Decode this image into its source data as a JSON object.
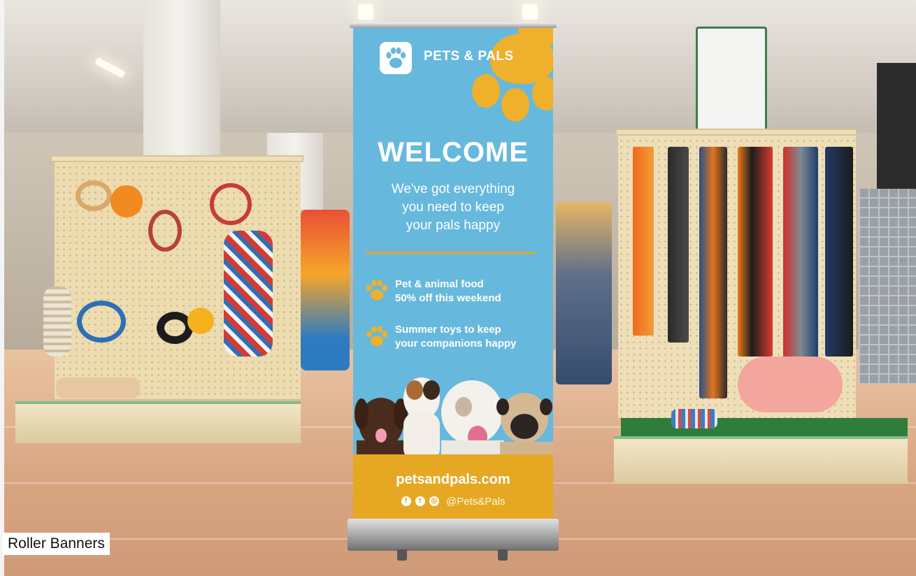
{
  "banner": {
    "brand": "PETS & PALS",
    "headline": "WELCOME",
    "subtitle_lines": [
      "We've got everything",
      "you need to keep",
      "your pals happy"
    ],
    "offers": [
      {
        "line1": "Pet & animal food",
        "line2": "50% off this weekend"
      },
      {
        "line1": "Summer toys to keep",
        "line2": "your companions happy"
      }
    ],
    "website": "petsandpals.com",
    "social_handle": "@Pets&Pals",
    "social_icons": [
      "facebook-icon",
      "twitter-icon",
      "instagram-icon"
    ],
    "colors": {
      "banner_blue": "#67b8dd",
      "accent_gold": "#e6a823",
      "paw_orange": "#efb02b"
    }
  },
  "caption": "Roller Banners"
}
